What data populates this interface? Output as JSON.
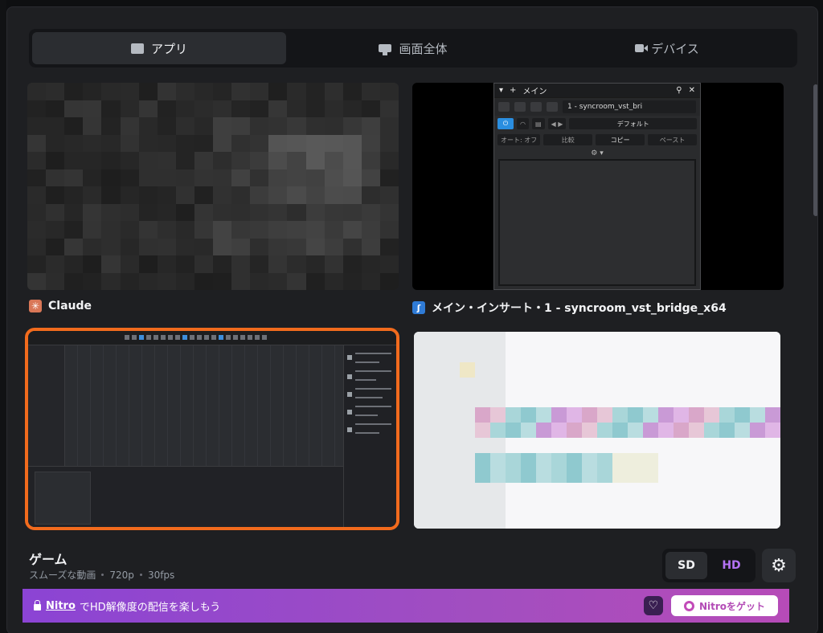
{
  "tabs": [
    {
      "label": "アプリ",
      "icon": "app-window-icon",
      "active": true
    },
    {
      "label": "画面全体",
      "icon": "monitor-icon",
      "active": false
    },
    {
      "label": "デバイス",
      "icon": "camera-icon",
      "active": false
    }
  ],
  "sources": [
    {
      "label": "Claude",
      "icon": "claude-icon"
    },
    {
      "label": "メイン・インサート・1 - syncroom_vst_bridge_x64",
      "icon": "plugin-app-icon"
    },
    {
      "label": "",
      "icon": ""
    },
    {
      "label": "",
      "icon": ""
    }
  ],
  "mini_window": {
    "title": "メイン",
    "preset_field": "1 - syncroom_vst_bri",
    "preset_name": "デフォルト",
    "auto_off": "オート: オフ",
    "compare": "比較",
    "copy": "コピー",
    "paste": "ペースト"
  },
  "selected": {
    "title": "ゲーム",
    "subtitle": "スムーズな動画",
    "resolution": "720p",
    "fps": "30fps"
  },
  "quality": {
    "sd": "SD",
    "hd": "HD"
  },
  "nitro": {
    "link": "Nitro",
    "message": "でHD解像度の配信を楽しもう",
    "button": "Nitroをゲット"
  },
  "colors": {
    "selected_border": "#f26b1d",
    "hd_text": "#b473f5",
    "nitro_gradient_start": "#8b44d4",
    "nitro_gradient_end": "#b64bb8"
  }
}
